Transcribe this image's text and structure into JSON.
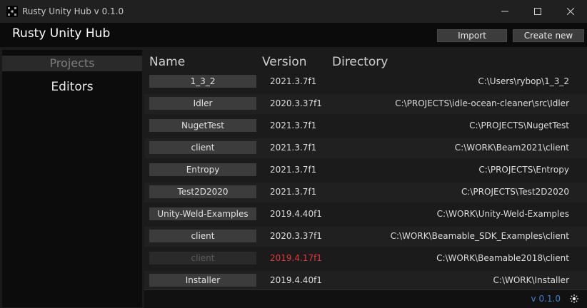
{
  "window": {
    "title": "Rusty Unity Hub v 0.1.0",
    "controls": [
      "minimize-icon",
      "maximize-icon",
      "close-icon"
    ]
  },
  "header": {
    "app_name": "Rusty Unity Hub",
    "import_label": "Import",
    "create_label": "Create new"
  },
  "sidebar": {
    "items": [
      {
        "label": "Projects",
        "selected": true
      },
      {
        "label": "Editors",
        "selected": false
      }
    ]
  },
  "table": {
    "columns": [
      "Name",
      "Version",
      "Directory"
    ],
    "rows": [
      {
        "name": "1_3_2",
        "version": "2021.3.7f1",
        "directory": "C:\\Users\\rybop\\1_3_2"
      },
      {
        "name": "Idler",
        "version": "2020.3.37f1",
        "directory": "C:\\PROJECTS\\idle-ocean-cleaner\\src\\Idler"
      },
      {
        "name": "NugetTest",
        "version": "2021.3.7f1",
        "directory": "C:\\PROJECTS\\NugetTest"
      },
      {
        "name": "client",
        "version": "2021.3.7f1",
        "directory": "C:\\WORK\\Beam2021\\client"
      },
      {
        "name": "Entropy",
        "version": "2021.3.7f1",
        "directory": "C:\\PROJECTS\\Entropy"
      },
      {
        "name": "Test2D2020",
        "version": "2021.3.7f1",
        "directory": "C:\\PROJECTS\\Test2D2020"
      },
      {
        "name": "Unity-Weld-Examples",
        "version": "2019.4.40f1",
        "directory": "C:\\WORK\\Unity-Weld-Examples"
      },
      {
        "name": "client",
        "version": "2020.3.37f1",
        "directory": "C:\\WORK\\Beamable_SDK_Examples\\client"
      },
      {
        "name": "client",
        "version": "2019.4.17f1",
        "directory": "C:\\WORK\\Beamable2018\\client"
      },
      {
        "name": "Installer",
        "version": "2019.4.40f1",
        "directory": "C:\\WORK\\Installer"
      }
    ]
  },
  "footer": {
    "version_label": "v 0.1.0",
    "theme_icon": "sun-icon"
  },
  "colors": {
    "missing_version": "#e23a3a",
    "link": "#3f7fd1"
  }
}
